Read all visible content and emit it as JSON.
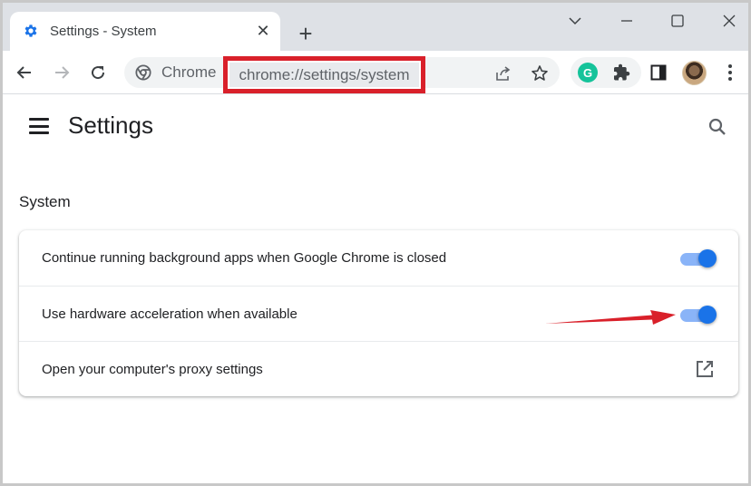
{
  "browser": {
    "tab": {
      "title": "Settings - System",
      "favicon": "gear-icon"
    },
    "omnibox": {
      "chip_label": "Chrome",
      "url": "chrome://settings/system"
    },
    "colors": {
      "accent": "#1a73e8",
      "highlight_border": "#d9202a",
      "grammarly": "#15c39a"
    }
  },
  "settings": {
    "title": "Settings",
    "section_title": "System",
    "rows": [
      {
        "label": "Continue running background apps when Google Chrome is closed",
        "control": "toggle",
        "enabled": true
      },
      {
        "label": "Use hardware acceleration when available",
        "control": "toggle",
        "enabled": true
      },
      {
        "label": "Open your computer's proxy settings",
        "control": "external-link"
      }
    ]
  },
  "annotation": {
    "arrow_color": "#d9202a",
    "highlight": "address-bar"
  }
}
